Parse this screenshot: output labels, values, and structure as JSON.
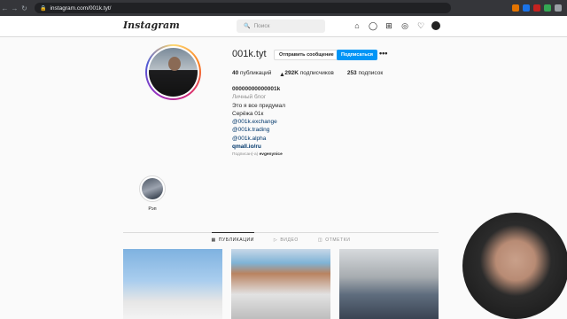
{
  "browser": {
    "url": "instagram.com/001k.tyt/"
  },
  "header": {
    "logo": "Instagram",
    "search_placeholder": "Поиск"
  },
  "profile": {
    "username": "001k.tyt",
    "message_button": "Отправить сообщение",
    "follow_button": "Подписаться",
    "more": "•••",
    "stats": {
      "posts_count": "40",
      "posts_label": "публикаций",
      "followers_count": "292K",
      "followers_label": "подписчиков",
      "following_count": "253",
      "following_label": "подписок"
    },
    "bio": {
      "name": "00000000000001k",
      "category": "Личный блог",
      "line1": "Это я все придумал",
      "line2": "Серёжа 01к",
      "link1": "@001k.exchange",
      "link2": "@001k.trading",
      "link3": "@001k.alpha",
      "website": "qmall.io/ru"
    },
    "followed_by_prefix": "Подписан(-а)",
    "followed_by_user": "evgenynice"
  },
  "highlights": [
    {
      "label": "Рэп"
    }
  ],
  "tabs": [
    {
      "label": "ПУБЛИКАЦИИ",
      "icon": "grid-icon",
      "active": true
    },
    {
      "label": "ВИДЕО",
      "icon": "video-icon",
      "active": false
    },
    {
      "label": "ОТМЕТКИ",
      "icon": "tag-icon",
      "active": false
    }
  ],
  "colors": {
    "accent": "#0095f6",
    "browser_bar": "#35363a"
  }
}
